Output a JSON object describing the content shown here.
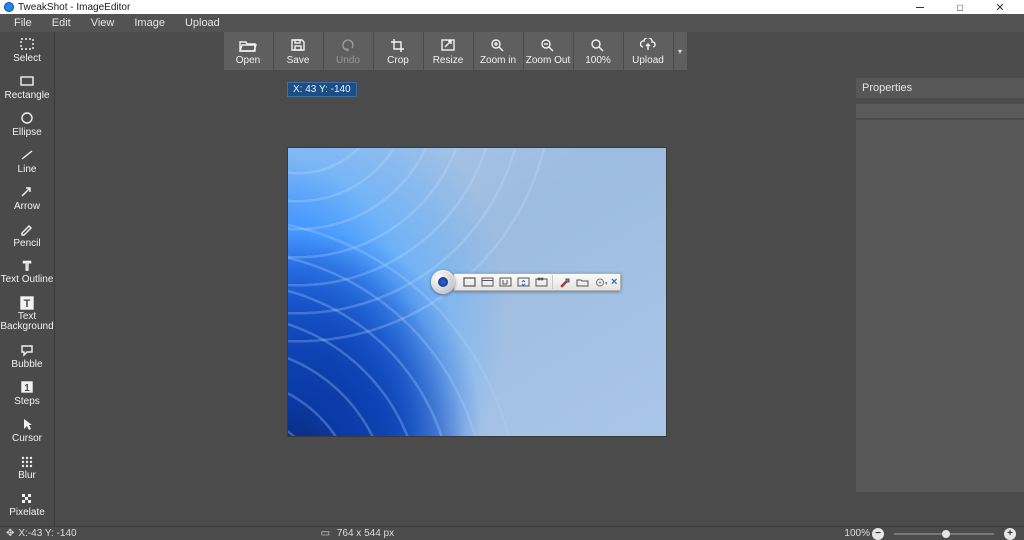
{
  "window": {
    "title": "TweakShot - ImageEditor"
  },
  "menu": {
    "items": [
      "File",
      "Edit",
      "View",
      "Image",
      "Upload"
    ]
  },
  "sidebar": {
    "tools": [
      {
        "label": "Select"
      },
      {
        "label": "Rectangle"
      },
      {
        "label": "Ellipse"
      },
      {
        "label": "Line"
      },
      {
        "label": "Arrow"
      },
      {
        "label": "Pencil"
      },
      {
        "label": "Text Outline"
      },
      {
        "label": "Text Background"
      },
      {
        "label": "Bubble"
      },
      {
        "label": "Steps"
      },
      {
        "label": "Cursor"
      },
      {
        "label": "Blur"
      },
      {
        "label": "Pixelate"
      }
    ]
  },
  "toolbar": {
    "buttons": [
      {
        "label": "Open"
      },
      {
        "label": "Save"
      },
      {
        "label": "Undo",
        "disabled": true
      },
      {
        "label": "Crop"
      },
      {
        "label": "Resize"
      },
      {
        "label": "Zoom in"
      },
      {
        "label": "Zoom Out"
      },
      {
        "label": "100%"
      },
      {
        "label": "Upload"
      }
    ]
  },
  "coord_badge": "X: 43 Y: -140",
  "properties": {
    "title": "Properties"
  },
  "status": {
    "coords": "X:-43 Y: -140",
    "dimensions": "764 x 544 px",
    "zoom": "100%"
  }
}
